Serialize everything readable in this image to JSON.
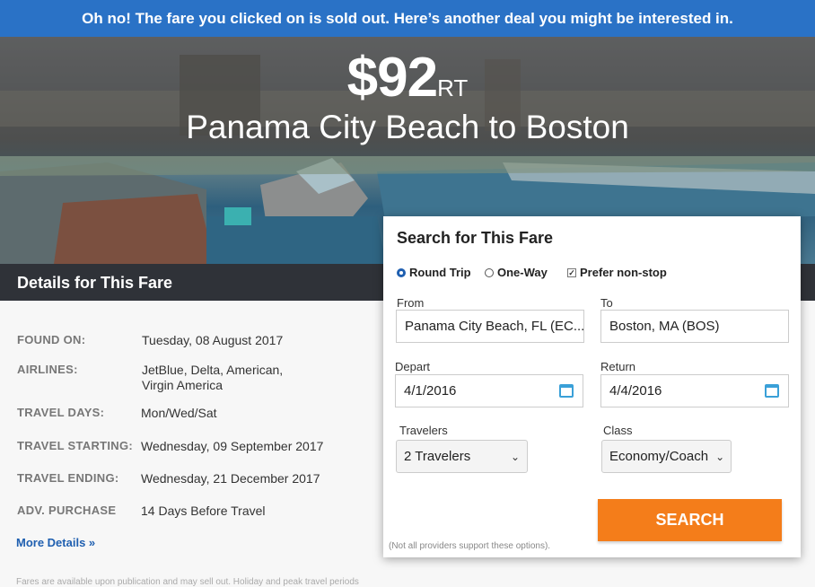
{
  "banner": {
    "text": "Oh no! The fare you clicked on is sold out. Here’s another deal you might be interested in."
  },
  "hero": {
    "price": "$92",
    "price_suffix": "RT",
    "route": "Panama City Beach to Boston"
  },
  "details": {
    "title": "Details for This Fare",
    "rows": [
      {
        "label": "FOUND ON:",
        "value": "Tuesday, 08 August 2017"
      },
      {
        "label": "AIRLINES:",
        "value": "JetBlue, Delta, American,",
        "value2": "Virgin America"
      },
      {
        "label": "TRAVEL DAYS:",
        "value": "Mon/Wed/Sat"
      },
      {
        "label": "TRAVEL STARTING:",
        "value": "Wednesday, 09 September 2017"
      },
      {
        "label": "TRAVEL ENDING:",
        "value": "Wednesday, 21 December 2017"
      },
      {
        "label": "ADV. PURCHASE",
        "value": "14 Days Before Travel"
      }
    ],
    "more_link": "More Details »",
    "fine_print": "Fares are available upon publication and may sell out. Holiday and peak travel periods"
  },
  "search": {
    "title": "Search for This Fare",
    "trip_options": {
      "round_trip": "Round Trip",
      "one_way": "One-Way",
      "selected": "round_trip"
    },
    "prefer_nonstop": {
      "label": "Prefer non-stop",
      "checked": true
    },
    "from": {
      "label": "From",
      "value": "Panama City Beach, FL (EC..."
    },
    "to": {
      "label": "To",
      "value": "Boston, MA (BOS)"
    },
    "depart": {
      "label": "Depart",
      "value": "4/1/2016"
    },
    "return": {
      "label": "Return",
      "value": "4/4/2016"
    },
    "travelers": {
      "label": "Travelers",
      "value": "2 Travelers"
    },
    "class": {
      "label": "Class",
      "value": "Economy/Coach"
    },
    "button": "SEARCH",
    "note": "(Not all providers support these options)."
  },
  "colors": {
    "banner": "#2a72c6",
    "accent": "#f47d1a",
    "link": "#1f5fb0",
    "details_bar": "#2f3238"
  }
}
